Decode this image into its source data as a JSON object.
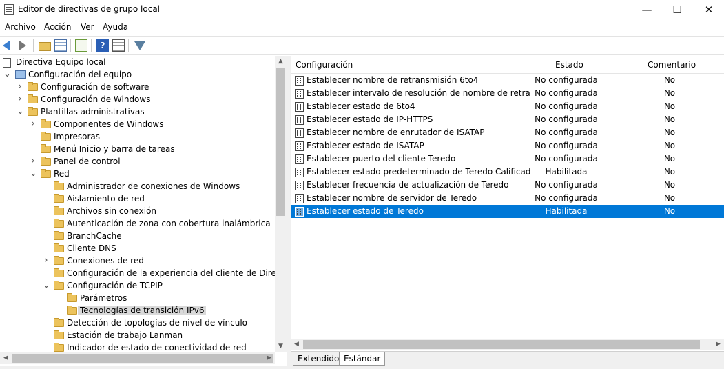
{
  "window": {
    "title": "Editor de directivas de grupo local",
    "minimize": "—",
    "maximize": "☐",
    "close": "✕"
  },
  "menu": [
    "Archivo",
    "Acción",
    "Ver",
    "Ayuda"
  ],
  "tree": {
    "items": [
      {
        "label": "Directiva Equipo local",
        "level": 0,
        "icon": "document-icon",
        "expander": ""
      },
      {
        "label": "Configuración del equipo",
        "level": 0,
        "icon": "computer-icon",
        "expander": "expanded"
      },
      {
        "label": "Configuración de software",
        "level": 1,
        "icon": "folder-icon",
        "expander": "collapsed"
      },
      {
        "label": "Configuración de Windows",
        "level": 1,
        "icon": "folder-icon",
        "expander": "collapsed"
      },
      {
        "label": "Plantillas administrativas",
        "level": 1,
        "icon": "folder-icon",
        "expander": "expanded"
      },
      {
        "label": "Componentes de Windows",
        "level": 2,
        "icon": "folder-icon",
        "expander": "collapsed"
      },
      {
        "label": "Impresoras",
        "level": 2,
        "icon": "folder-icon",
        "expander": ""
      },
      {
        "label": "Menú Inicio y barra de tareas",
        "level": 2,
        "icon": "folder-icon",
        "expander": ""
      },
      {
        "label": "Panel de control",
        "level": 2,
        "icon": "folder-icon",
        "expander": "collapsed"
      },
      {
        "label": "Red",
        "level": 2,
        "icon": "folder-icon",
        "expander": "expanded"
      },
      {
        "label": "Administrador de conexiones de Windows",
        "level": 3,
        "icon": "folder-icon",
        "expander": ""
      },
      {
        "label": "Aislamiento de red",
        "level": 3,
        "icon": "folder-icon",
        "expander": ""
      },
      {
        "label": "Archivos sin conexión",
        "level": 3,
        "icon": "folder-icon",
        "expander": ""
      },
      {
        "label": "Autenticación de zona con cobertura inalámbrica",
        "level": 3,
        "icon": "folder-icon",
        "expander": ""
      },
      {
        "label": "BranchCache",
        "level": 3,
        "icon": "folder-icon",
        "expander": ""
      },
      {
        "label": "Cliente DNS",
        "level": 3,
        "icon": "folder-icon",
        "expander": ""
      },
      {
        "label": "Conexiones de red",
        "level": 3,
        "icon": "folder-icon",
        "expander": "collapsed"
      },
      {
        "label": "Configuración de la experiencia del cliente de DirectAcce",
        "level": 3,
        "icon": "folder-icon",
        "expander": ""
      },
      {
        "label": "Configuración de TCPIP",
        "level": 3,
        "icon": "folder-icon",
        "expander": "expanded"
      },
      {
        "label": "Parámetros",
        "level": 4,
        "icon": "folder-icon",
        "expander": ""
      },
      {
        "label": "Tecnologías de transición IPv6",
        "level": 4,
        "icon": "folder-icon",
        "expander": "",
        "selected": true
      },
      {
        "label": "Detección de topologías de nivel de vínculo",
        "level": 3,
        "icon": "folder-icon",
        "expander": ""
      },
      {
        "label": "Estación de trabajo Lanman",
        "level": 3,
        "icon": "folder-icon",
        "expander": ""
      },
      {
        "label": "Indicador de estado de conectividad de red",
        "level": 3,
        "icon": "folder-icon",
        "expander": ""
      }
    ]
  },
  "list": {
    "columns": {
      "name": "Configuración",
      "state": "Estado",
      "comment": "Comentario"
    },
    "rows": [
      {
        "name": "Establecer nombre de retransmisión 6to4",
        "state": "No configurada",
        "comment": "No"
      },
      {
        "name": "Establecer intervalo de resolución de nombre de retransmisi...",
        "state": "No configurada",
        "comment": "No"
      },
      {
        "name": "Establecer estado de 6to4",
        "state": "No configurada",
        "comment": "No"
      },
      {
        "name": "Establecer estado de IP-HTTPS",
        "state": "No configurada",
        "comment": "No"
      },
      {
        "name": "Establecer nombre de enrutador de ISATAP",
        "state": "No configurada",
        "comment": "No"
      },
      {
        "name": "Establecer estado de ISATAP",
        "state": "No configurada",
        "comment": "No"
      },
      {
        "name": "Establecer puerto del cliente Teredo",
        "state": "No configurada",
        "comment": "No"
      },
      {
        "name": "Establecer estado predeterminado de Teredo Calificado",
        "state": "Habilitada",
        "comment": "No"
      },
      {
        "name": "Establecer frecuencia de actualización de Teredo",
        "state": "No configurada",
        "comment": "No"
      },
      {
        "name": "Establecer nombre de servidor de Teredo",
        "state": "No configurada",
        "comment": "No"
      },
      {
        "name": "Establecer estado de Teredo",
        "state": "Habilitada",
        "comment": "No",
        "selected": true
      }
    ]
  },
  "tabs": [
    "Extendido",
    "Estándar"
  ],
  "active_tab": "Estándar",
  "colors": {
    "selection": "#0078d7",
    "tree_selection": "#d9d9d9"
  }
}
